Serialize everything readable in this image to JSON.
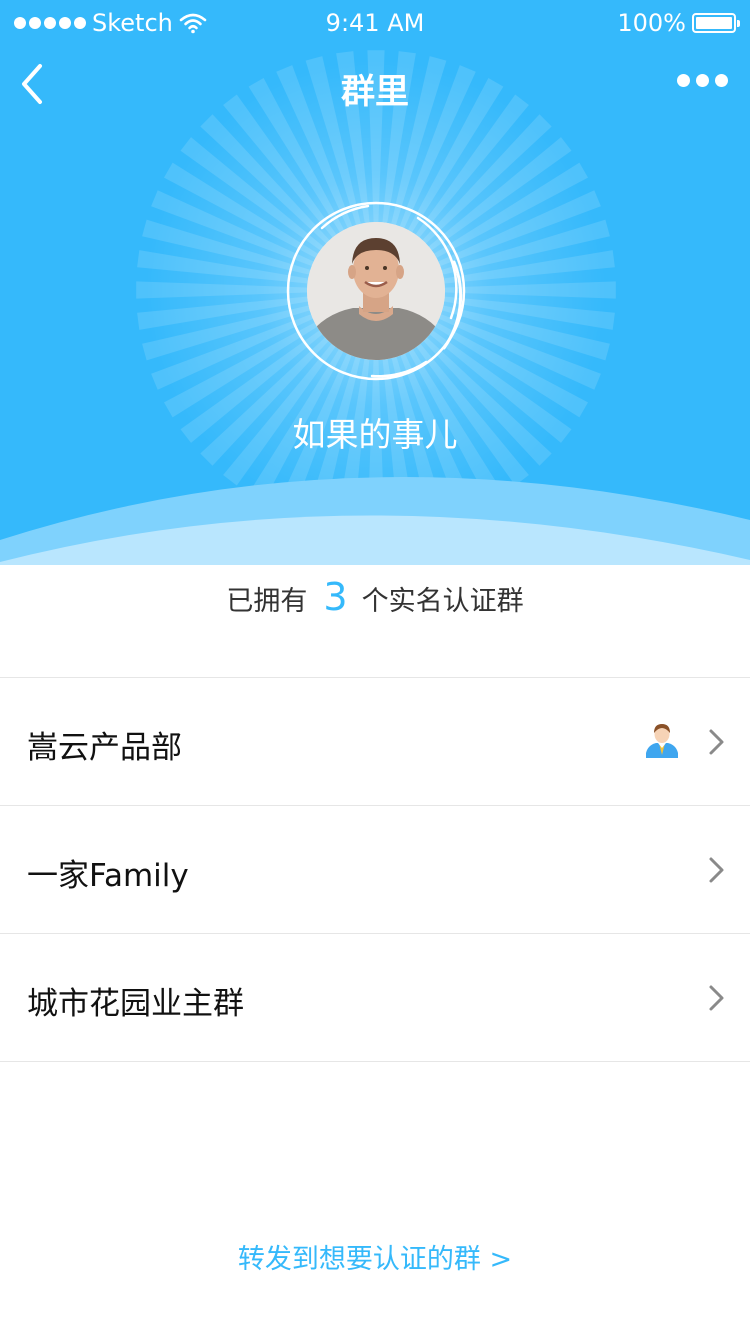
{
  "status_bar": {
    "carrier": "Sketch",
    "time": "9:41 AM",
    "battery": "100%",
    "battery_level": 1.0
  },
  "nav": {
    "title": "群里",
    "back_icon": "chevron-left-icon",
    "more_icon": "more-horizontal-icon"
  },
  "profile": {
    "name": "如果的事儿"
  },
  "summary": {
    "prefix": "已拥有",
    "count": "3",
    "suffix": "个实名认证群"
  },
  "groups": [
    {
      "name": "嵩云产品部",
      "has_member_icon": true
    },
    {
      "name": "一家Family",
      "has_member_icon": false
    },
    {
      "name": "城市花园业主群",
      "has_member_icon": false
    }
  ],
  "footer": {
    "forward_label": "转发到想要认证的群 >"
  },
  "colors": {
    "accent": "#35b9fb",
    "hero_dark": "#2aa8f5",
    "text": "#222222",
    "divider": "#e6e6e6"
  }
}
